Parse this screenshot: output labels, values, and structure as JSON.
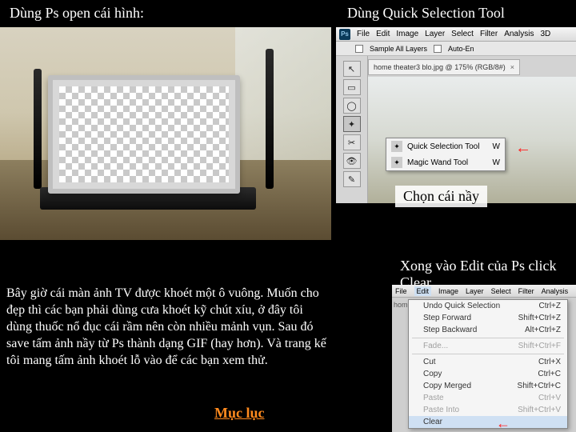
{
  "headings": {
    "left": "Dùng Ps open cái hình:",
    "rightTop": "Dùng Quick Selection Tool",
    "rightMid": "Xong vào Edit của Ps click Clear"
  },
  "paragraph": "Bây giờ cái màn ảnh TV được khoét một ô vuông. Muốn cho đẹp thì các bạn phải dùng cưa khoét kỹ chút xíu, ở đây tôi dùng thuốc nổ đục cái rầm nên còn nhiều mảnh vụn. Sau đó save tấm ảnh nầy từ Ps thành dạng GIF (hay hơn). Và trang kế tôi mang tấm ảnh khoét lỗ vào để các bạn xem thử.",
  "chonLabel": "Chọn cái nầy",
  "mucluc": "Mục lục",
  "ps": {
    "logo": "Ps",
    "menu": [
      "File",
      "Edit",
      "Image",
      "Layer",
      "Select",
      "Filter",
      "Analysis",
      "3D"
    ],
    "options": {
      "sampleAll": "Sample All Layers",
      "autoEn": "Auto-En"
    },
    "tab": "home theater3 blo.jpg @ 175% (RGB/8#)",
    "tabClose": "×",
    "flyout": {
      "quick": "Quick Selection Tool",
      "magic": "Magic Wand Tool",
      "shortcut": "W"
    }
  },
  "editMenu": {
    "menuBar": [
      "File",
      "Edit",
      "Image",
      "Layer",
      "Select",
      "Filter",
      "Analysis"
    ],
    "homeTab": "hom",
    "items": [
      {
        "label": "Undo Quick Selection",
        "shortcut": "Ctrl+Z",
        "disabled": false
      },
      {
        "label": "Step Forward",
        "shortcut": "Shift+Ctrl+Z",
        "disabled": false
      },
      {
        "label": "Step Backward",
        "shortcut": "Alt+Ctrl+Z",
        "disabled": false
      }
    ],
    "fade": {
      "label": "Fade...",
      "shortcut": "Shift+Ctrl+F"
    },
    "items2": [
      {
        "label": "Cut",
        "shortcut": "Ctrl+X"
      },
      {
        "label": "Copy",
        "shortcut": "Ctrl+C"
      },
      {
        "label": "Copy Merged",
        "shortcut": "Shift+Ctrl+C"
      },
      {
        "label": "Paste",
        "shortcut": "Ctrl+V"
      },
      {
        "label": "Paste Into",
        "shortcut": "Shift+Ctrl+V"
      },
      {
        "label": "Clear",
        "shortcut": ""
      }
    ]
  },
  "icons": {
    "move": "↖",
    "marquee": "▭",
    "lasso": "◯",
    "wand": "✦",
    "crop": "✂",
    "eyedrop": "👁",
    "brush": "✎",
    "arrowLeft": "←"
  }
}
